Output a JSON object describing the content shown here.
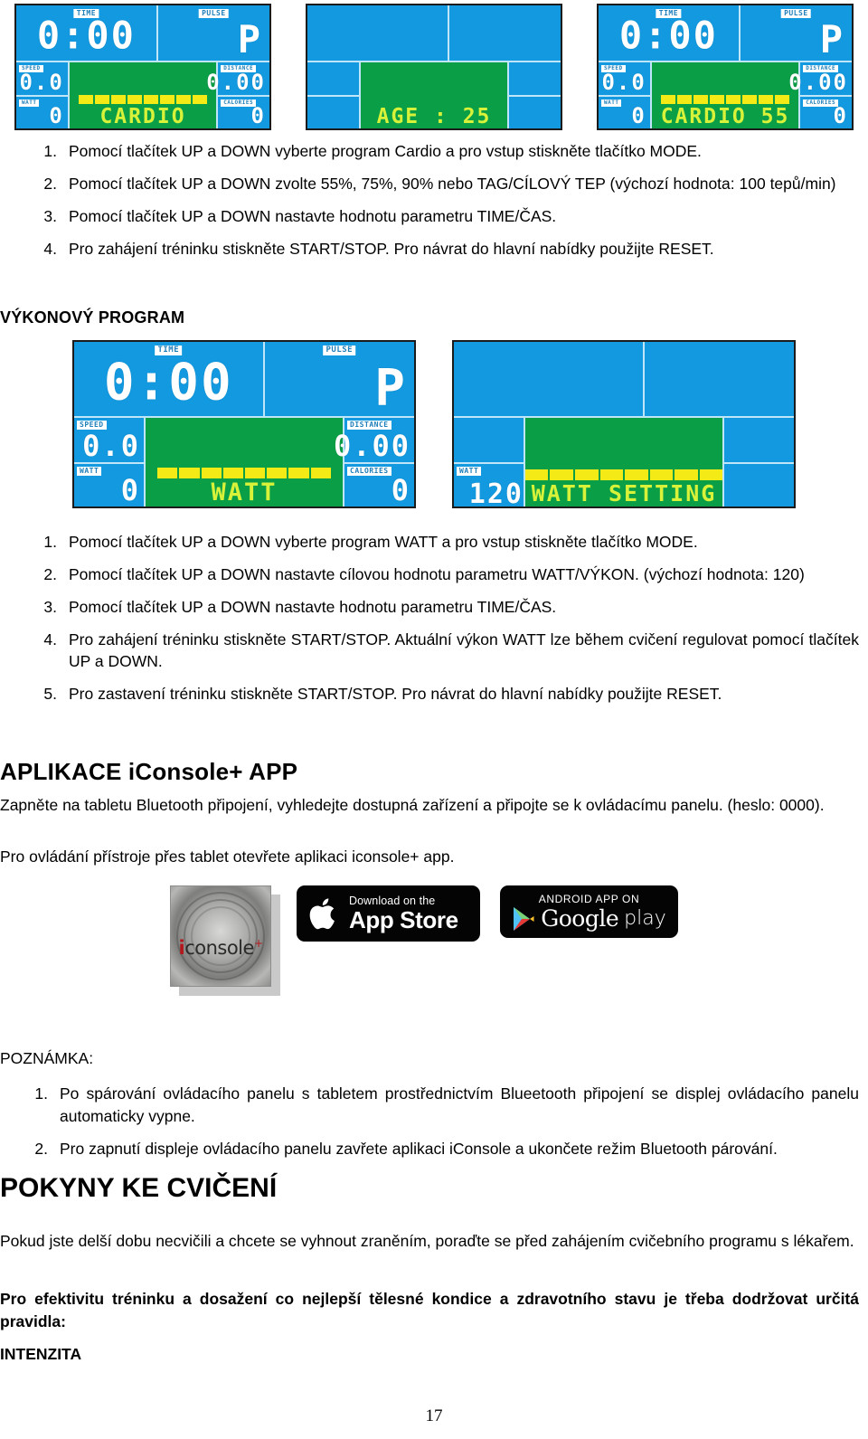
{
  "colors": {
    "lcd_blue": "#1399e0",
    "lcd_green": "#0a9e46",
    "lcd_yellow": "#f3ea16",
    "lcd_text_yellow": "#d8f23a",
    "lcd_segment_white": "#ffffff",
    "lcd_border": "#1b1b1b",
    "logo_red": "#b3171c"
  },
  "displays": {
    "cardio_select": {
      "tag_time": "TIME",
      "tag_pulse": "PULSE",
      "tag_speed": "SPEED",
      "tag_distance": "DISTANCE",
      "tag_watt": "WATT",
      "tag_calories": "CALORIES",
      "time_value": "0:00",
      "pulse_value": "P",
      "speed_value": "0.0",
      "distance_value": "0.00",
      "watt_value": "0",
      "calories_value": "0",
      "message": "CARDIO"
    },
    "age_setting": {
      "message": "AGE : 25"
    },
    "cardio_55": {
      "tag_time": "TIME",
      "tag_pulse": "PULSE",
      "tag_speed": "SPEED",
      "tag_distance": "DISTANCE",
      "tag_watt": "WATT",
      "tag_calories": "CALORIES",
      "time_value": "0:00",
      "pulse_value": "P",
      "speed_value": "0.0",
      "distance_value": "0.00",
      "watt_value": "0",
      "calories_value": "0",
      "message": "CARDIO 55"
    },
    "watt_select": {
      "tag_time": "TIME",
      "tag_pulse": "PULSE",
      "tag_speed": "SPEED",
      "tag_distance": "DISTANCE",
      "tag_watt": "WATT",
      "tag_calories": "CALORIES",
      "time_value": "0:00",
      "pulse_value": "P",
      "speed_value": "0.0",
      "distance_value": "0.00",
      "watt_value": "0",
      "calories_value": "0",
      "message": "WATT"
    },
    "watt_setting": {
      "tag_watt": "WATT",
      "watt_value": "120",
      "message": "WATT SETTING"
    }
  },
  "cardio_steps": [
    {
      "num": "1.",
      "text": "Pomocí tlačítek UP a DOWN vyberte program Cardio a pro vstup stiskněte tlačítko MODE."
    },
    {
      "num": "2.",
      "text": "Pomocí tlačítek UP a DOWN zvolte 55%, 75%, 90% nebo TAG/CÍLOVÝ TEP (výchozí hodnota: 100 tepů/min)"
    },
    {
      "num": "3.",
      "text": "Pomocí tlačítek UP a DOWN nastavte hodnotu parametru TIME/ČAS."
    },
    {
      "num": "4.",
      "text": "Pro zahájení tréninku stiskněte START/STOP. Pro návrat do hlavní nabídky použijte RESET."
    }
  ],
  "watt_section": {
    "heading": "VÝKONOVÝ PROGRAM",
    "steps": [
      {
        "num": "1.",
        "text": "Pomocí tlačítek UP a DOWN vyberte program WATT a pro vstup stiskněte tlačítko MODE."
      },
      {
        "num": "2.",
        "text": "Pomocí tlačítek UP a DOWN nastavte cílovou hodnotu parametru WATT/VÝKON. (výchozí hodnota: 120)"
      },
      {
        "num": "3.",
        "text": "Pomocí tlačítek UP a DOWN nastavte hodnotu parametru TIME/ČAS."
      },
      {
        "num": "4.",
        "text": "Pro zahájení tréninku stiskněte START/STOP. Aktuální výkon WATT lze během cvičení regulovat pomocí tlačítek UP a DOWN."
      },
      {
        "num": "5.",
        "text": "Pro zastavení tréninku stiskněte START/STOP. Pro návrat do hlavní nabídky použijte RESET."
      }
    ]
  },
  "app_section": {
    "heading": "APLIKACE iConsole+ APP",
    "paragraph1": "Zapněte na tabletu Bluetooth připojení, vyhledejte dostupná zařízení a připojte se k ovládacímu panelu. (heslo: 0000).",
    "paragraph2": "Pro ovládání přístroje přes tablet otevřete aplikaci iconsole+ app.",
    "badges": {
      "iconsole_word": "console",
      "iconsole_initial": "i",
      "iconsole_plus": "+",
      "apple_line1": "Download on the",
      "apple_line2": "App Store",
      "google_line1": "ANDROID APP ON",
      "google_word": "Google",
      "google_play": "play"
    }
  },
  "note_section": {
    "heading": "POZNÁMKA:",
    "items": [
      {
        "num": "1.",
        "text": "Po spárování ovládacího panelu s tabletem prostřednictvím Blueetooth připojení se displej ovládacího panelu automaticky vypne."
      },
      {
        "num": "2.",
        "text": "Pro zapnutí displeje ovládacího panelu zavřete aplikaci iConsole a ukončete režim Bluetooth párování."
      }
    ]
  },
  "exercise_section": {
    "heading": "POKYNY KE CVIČENÍ",
    "paragraph1": "Pokud jste delší dobu necvičili a chcete se vyhnout zraněním, poraďte se před zahájením cvičebního programu s lékařem.",
    "paragraph2": "Pro efektivitu tréninku a dosažení co nejlepší tělesné kondice a zdravotního stavu je třeba dodržovat určitá pravidla:",
    "subheading": "INTENZITA"
  },
  "footer": {
    "page_number": "17"
  }
}
